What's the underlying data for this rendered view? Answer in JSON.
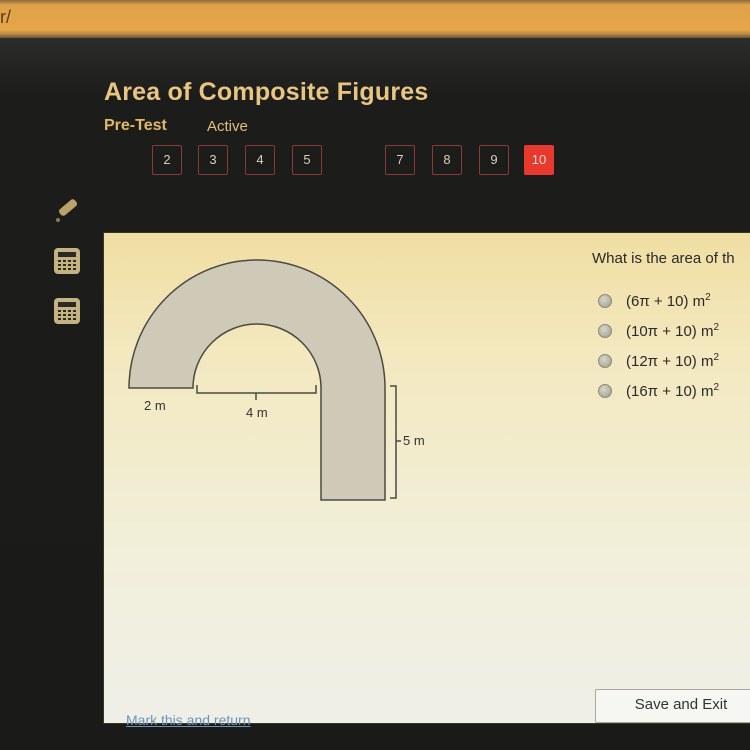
{
  "browser": {
    "url_fragment": "r/"
  },
  "header": {
    "title": "Area of Composite Figures",
    "subtitle": "Pre-Test",
    "status": "Active"
  },
  "question_nav": [
    {
      "label": "2",
      "current": false
    },
    {
      "label": "3",
      "current": false
    },
    {
      "label": "4",
      "current": false
    },
    {
      "label": "5",
      "current": false
    },
    {
      "label": "7",
      "current": false
    },
    {
      "label": "8",
      "current": false
    },
    {
      "label": "9",
      "current": false
    },
    {
      "label": "10",
      "current": true
    }
  ],
  "tools": [
    {
      "name": "pencil-icon"
    },
    {
      "name": "calculator-icon"
    },
    {
      "name": "calculator-icon"
    }
  ],
  "figure": {
    "labels": {
      "width_left": "2 m",
      "inner_diameter": "4 m",
      "rect_height": "5 m"
    },
    "fill_color": "#cfcab8",
    "stroke_color": "#4a4a42"
  },
  "question": {
    "text": "What is the area of th",
    "options": [
      {
        "text": "(6π + 10) m",
        "sup": "2"
      },
      {
        "text": "(10π + 10) m",
        "sup": "2"
      },
      {
        "text": "(12π + 10) m",
        "sup": "2"
      },
      {
        "text": "(16π + 10) m",
        "sup": "2"
      }
    ]
  },
  "footer": {
    "mark_link": "Mark this and return",
    "save_button": "Save and Exit"
  },
  "colors": {
    "accent": "#e8392e",
    "title": "#e8c682",
    "link": "#6a94b8"
  }
}
